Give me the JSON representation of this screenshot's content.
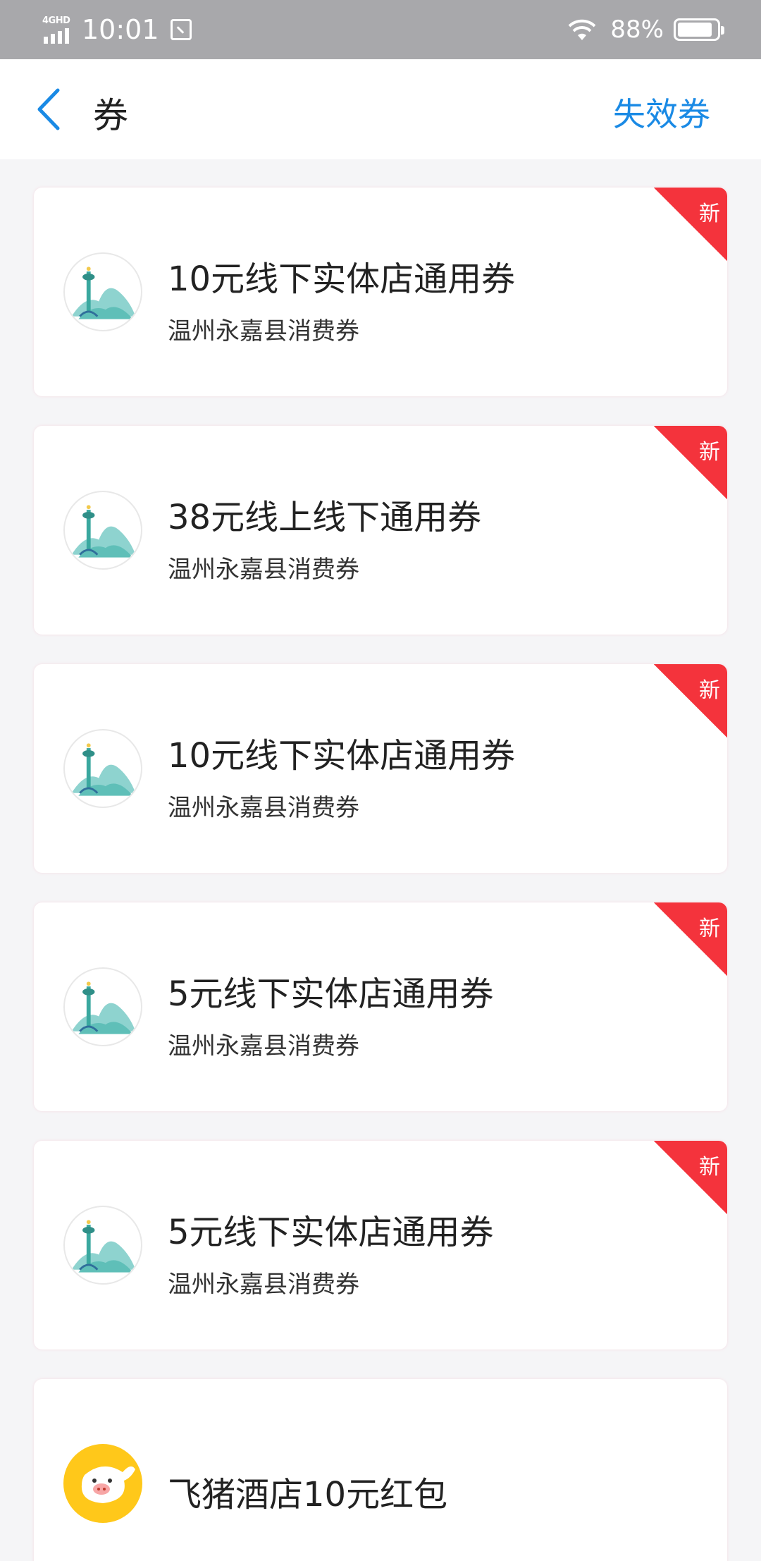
{
  "status_bar": {
    "network": "4GHD",
    "time": "10:01",
    "battery_percent": "88%",
    "battery_level": 0.88
  },
  "header": {
    "title": "券",
    "invalid_link": "失效券"
  },
  "coupons": [
    {
      "title": "10元线下实体店通用券",
      "subtitle": "温州永嘉县消费券",
      "badge": "新",
      "logo": "yongjia-landmark-logo"
    },
    {
      "title": "38元线上线下通用券",
      "subtitle": "温州永嘉县消费券",
      "badge": "新",
      "logo": "yongjia-landmark-logo"
    },
    {
      "title": "10元线下实体店通用券",
      "subtitle": "温州永嘉县消费券",
      "badge": "新",
      "logo": "yongjia-landmark-logo"
    },
    {
      "title": "5元线下实体店通用券",
      "subtitle": "温州永嘉县消费券",
      "badge": "新",
      "logo": "yongjia-landmark-logo"
    },
    {
      "title": "5元线下实体店通用券",
      "subtitle": "温州永嘉县消费券",
      "badge": "新",
      "logo": "yongjia-landmark-logo"
    },
    {
      "title": "飞猪酒店10元红包",
      "logo": "fliggy-pig-logo"
    }
  ],
  "colors": {
    "accent": "#1a8ae5",
    "badge_red": "#f4333c",
    "status_bar": "#a8a8ab",
    "background": "#f5f5f7"
  }
}
